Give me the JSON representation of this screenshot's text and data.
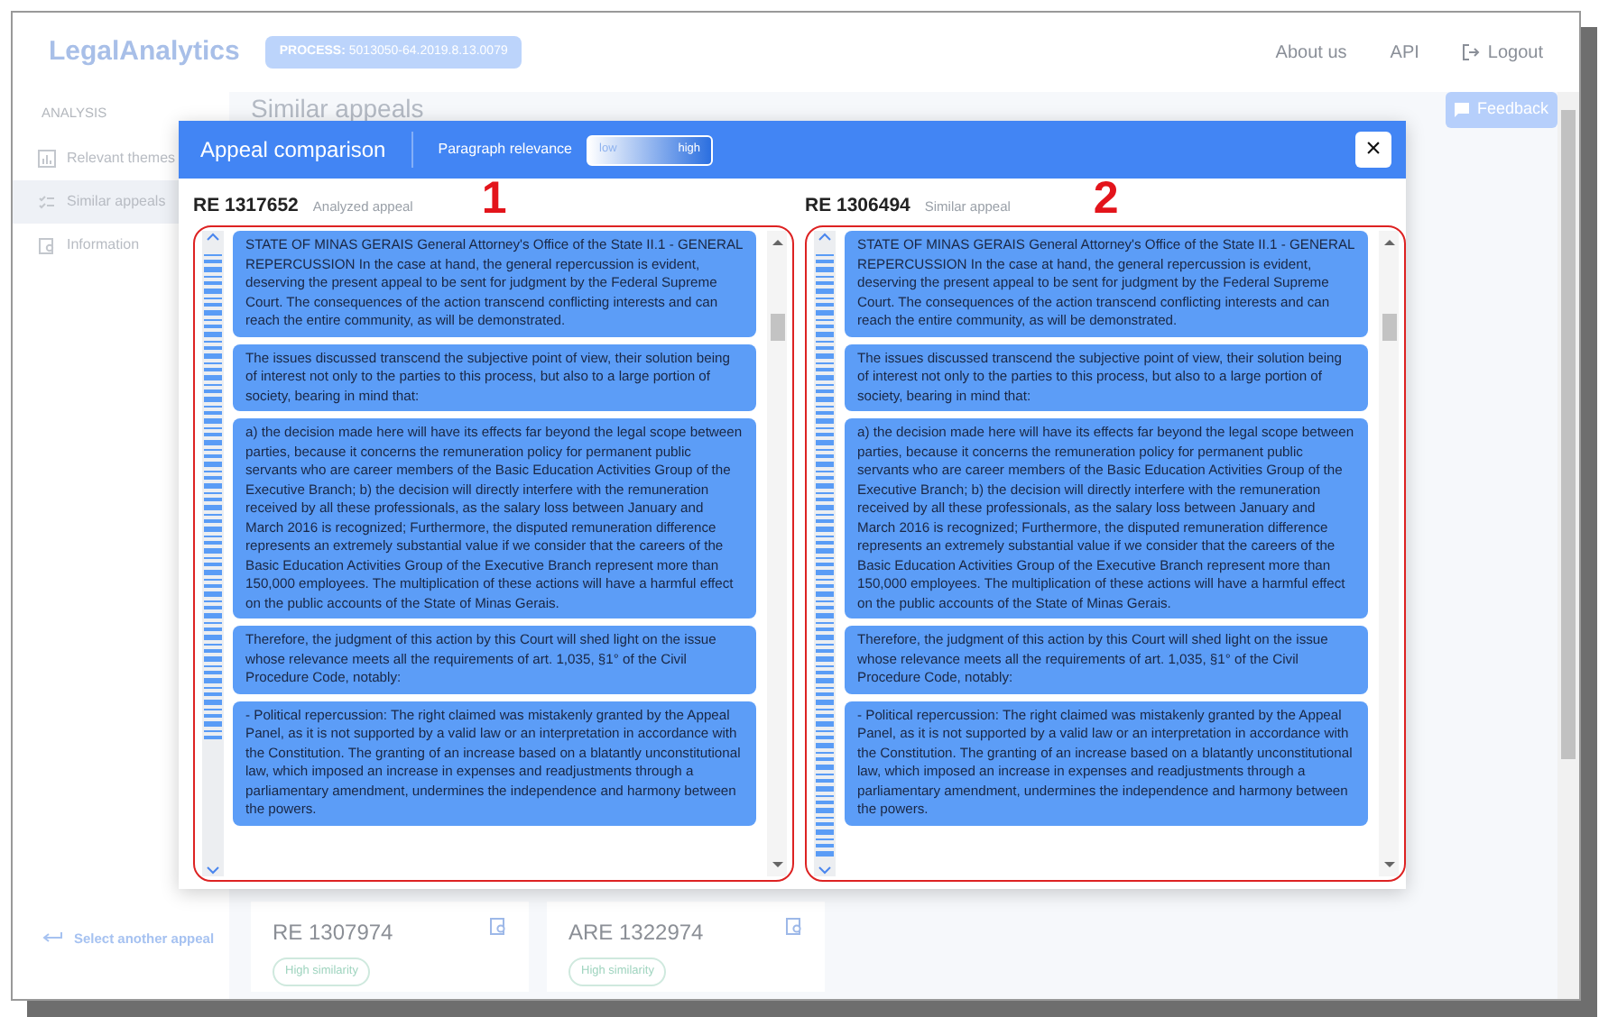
{
  "header": {
    "logo": "LegalAnalytics",
    "process_label": "PROCESS:",
    "process_number": "5013050-64.2019.8.13.0079",
    "nav": [
      {
        "label": "About us",
        "kind": "link"
      },
      {
        "label": "API",
        "kind": "link"
      },
      {
        "label": "Logout",
        "kind": "logout"
      }
    ]
  },
  "sidebar": {
    "section": "ANALYSIS",
    "items": [
      {
        "label": "Relevant themes",
        "selected": false
      },
      {
        "label": "Similar appeals",
        "selected": true
      },
      {
        "label": "Information",
        "selected": false
      }
    ],
    "back_link": "Select another appeal"
  },
  "main": {
    "title": "Similar appeals",
    "feedback_button": "Feedback",
    "cards": [
      {
        "code": "RE 1307974",
        "badge": "High similarity"
      },
      {
        "code": "ARE 1322974",
        "badge": "High similarity"
      }
    ]
  },
  "modal": {
    "title": "Appeal comparison",
    "legend": {
      "label": "Paragraph relevance",
      "low": "low",
      "high": "high"
    },
    "close": "×",
    "panels": [
      {
        "code": "RE 1317652",
        "caption": "Analyzed appeal",
        "annotation": "1",
        "paragraphs": [
          "STATE OF MINAS GERAIS General Attorney's Office of the State II.1 - GENERAL REPERCUSSION In the case at hand, the general repercussion is evident, deserving the present appeal to be sent for judgment by the Federal Supreme Court. The consequences of the action transcend conflicting interests and can reach the entire community, as will be demonstrated.",
          "The issues discussed transcend the subjective point of view, their solution being of interest not only to the parties to this process, but also to a large portion of society, bearing in mind that:",
          "a) the decision made here will have its effects far beyond the legal scope between parties, because it concerns the remuneration policy for permanent public servants who are career members of the Basic Education Activities Group of the Executive Branch; b) the decision will directly interfere with the remuneration received by all these professionals, as the salary loss between January and March 2016 is recognized; Furthermore, the disputed remuneration difference represents an extremely substantial value if we consider that the careers of the Basic Education Activities Group of the Executive Branch represent more than 150,000 employees. The multiplication of these actions will have a harmful effect on the public accounts of the State of Minas Gerais.",
          "Therefore, the judgment of this action by this Court will shed light on the issue whose relevance meets all the requirements of art. 1,035, §1° of the Civil Procedure Code, notably:",
          "- Political repercussion: The right claimed was mistakenly granted by the Appeal Panel, as it is not supported by a valid law or an interpretation in accordance with the Constitution. The granting of an increase based on a blatantly unconstitutional law, which imposed an increase in expenses and readjustments through a parliamentary amendment, undermines the independence and harmony between the powers."
        ]
      },
      {
        "code": "RE 1306494",
        "caption": "Similar appeal",
        "annotation": "2",
        "paragraphs": [
          "STATE OF MINAS GERAIS General Attorney's Office of the State II.1 - GENERAL REPERCUSSION In the case at hand, the general repercussion is evident, deserving the present appeal to be sent for judgment by the Federal Supreme Court. The consequences of the action transcend conflicting interests and can reach the entire community, as will be demonstrated.",
          "The issues discussed transcend the subjective point of view, their solution being of interest not only to the parties to this process, but also to a large portion of society, bearing in mind that:",
          "a) the decision made here will have its effects far beyond the legal scope between parties, because it concerns the remuneration policy for permanent public servants who are career members of the Basic Education Activities Group of the Executive Branch; b) the decision will directly interfere with the remuneration received by all these professionals, as the salary loss between January and March 2016 is recognized; Furthermore, the disputed remuneration difference represents an extremely substantial value if we consider that the careers of the Basic Education Activities Group of the Executive Branch represent more than 150,000 employees. The multiplication of these actions will have a harmful effect on the public accounts of the State of Minas Gerais.",
          "Therefore, the judgment of this action by this Court will shed light on the issue whose relevance meets all the requirements of art. 1,035, §1° of the Civil Procedure Code, notably:",
          "- Political repercussion: The right claimed was mistakenly granted by the Appeal Panel, as it is not supported by a valid law or an interpretation in accordance with the Constitution. The granting of an increase based on a blatantly unconstitutional law, which imposed an increase in expenses and readjustments through a parliamentary amendment, undermines the independence and harmony between the powers."
        ]
      }
    ]
  }
}
